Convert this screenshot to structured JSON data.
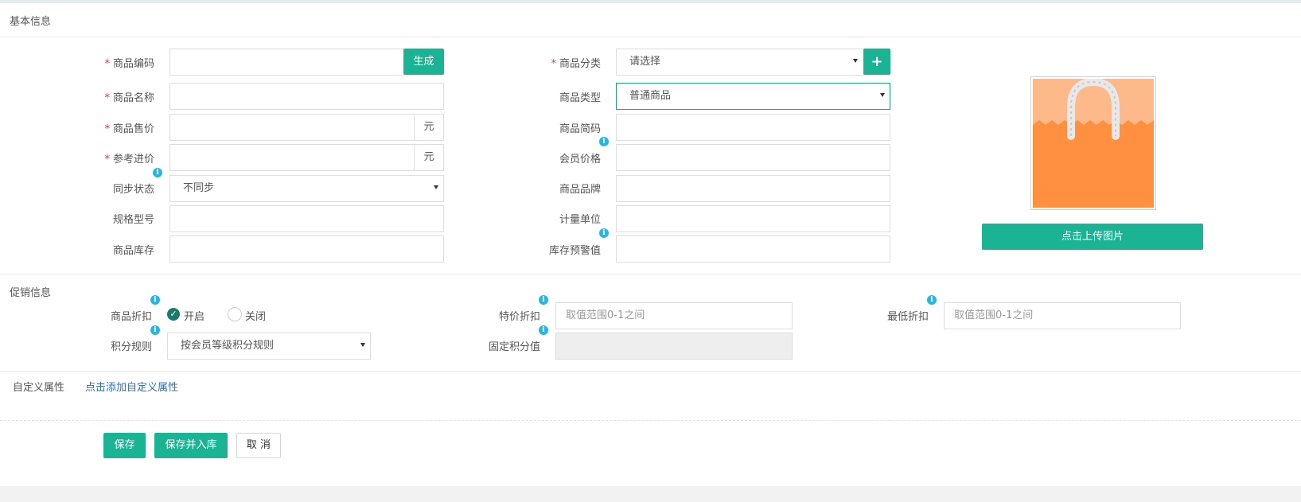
{
  "sections": {
    "basic": "基本信息",
    "promo": "促销信息",
    "custom": "自定义属性",
    "custom_link": "点击添加自定义属性"
  },
  "required_mark": "*",
  "left_fields": {
    "code": {
      "label": "商品编码",
      "value": "",
      "button": "生成"
    },
    "name": {
      "label": "商品名称",
      "value": ""
    },
    "price": {
      "label": "商品售价",
      "value": "",
      "unit": "元"
    },
    "cost": {
      "label": "参考进价",
      "value": "",
      "unit": "元"
    },
    "sync": {
      "label": "同步状态",
      "value": "不同步"
    },
    "spec": {
      "label": "规格型号",
      "value": ""
    },
    "stock": {
      "label": "商品库存",
      "value": ""
    }
  },
  "right_fields": {
    "category": {
      "label": "商品分类",
      "value": "请选择",
      "add_icon": "plus-icon"
    },
    "type": {
      "label": "商品类型",
      "value": "普通商品"
    },
    "short_code": {
      "label": "商品简码",
      "value": ""
    },
    "member_price": {
      "label": "会员价格",
      "value": ""
    },
    "brand": {
      "label": "商品品牌",
      "value": ""
    },
    "unit": {
      "label": "计量单位",
      "value": ""
    },
    "stock_warning": {
      "label": "库存预警值",
      "value": ""
    }
  },
  "image": {
    "upload_button": "点击上传图片",
    "icon": "shopping-bag-image"
  },
  "promo": {
    "discount": {
      "label": "商品折扣",
      "on": "开启",
      "off": "关闭",
      "selected": "开启"
    },
    "points_rule": {
      "label": "积分规则",
      "value": "按会员等级积分规则"
    },
    "special_discount": {
      "label": "特价折扣",
      "placeholder": "取值范围0-1之间"
    },
    "fixed_points": {
      "label": "固定积分值",
      "value": ""
    },
    "min_discount": {
      "label": "最低折扣",
      "placeholder": "取值范围0-1之间"
    }
  },
  "actions": {
    "save": "保存",
    "save_stock": "保存并入库",
    "cancel": "取 消"
  },
  "colors": {
    "accent": "#1ab394",
    "info": "#23b7e5",
    "required": "#e4393c",
    "link": "#2a6fb4"
  }
}
